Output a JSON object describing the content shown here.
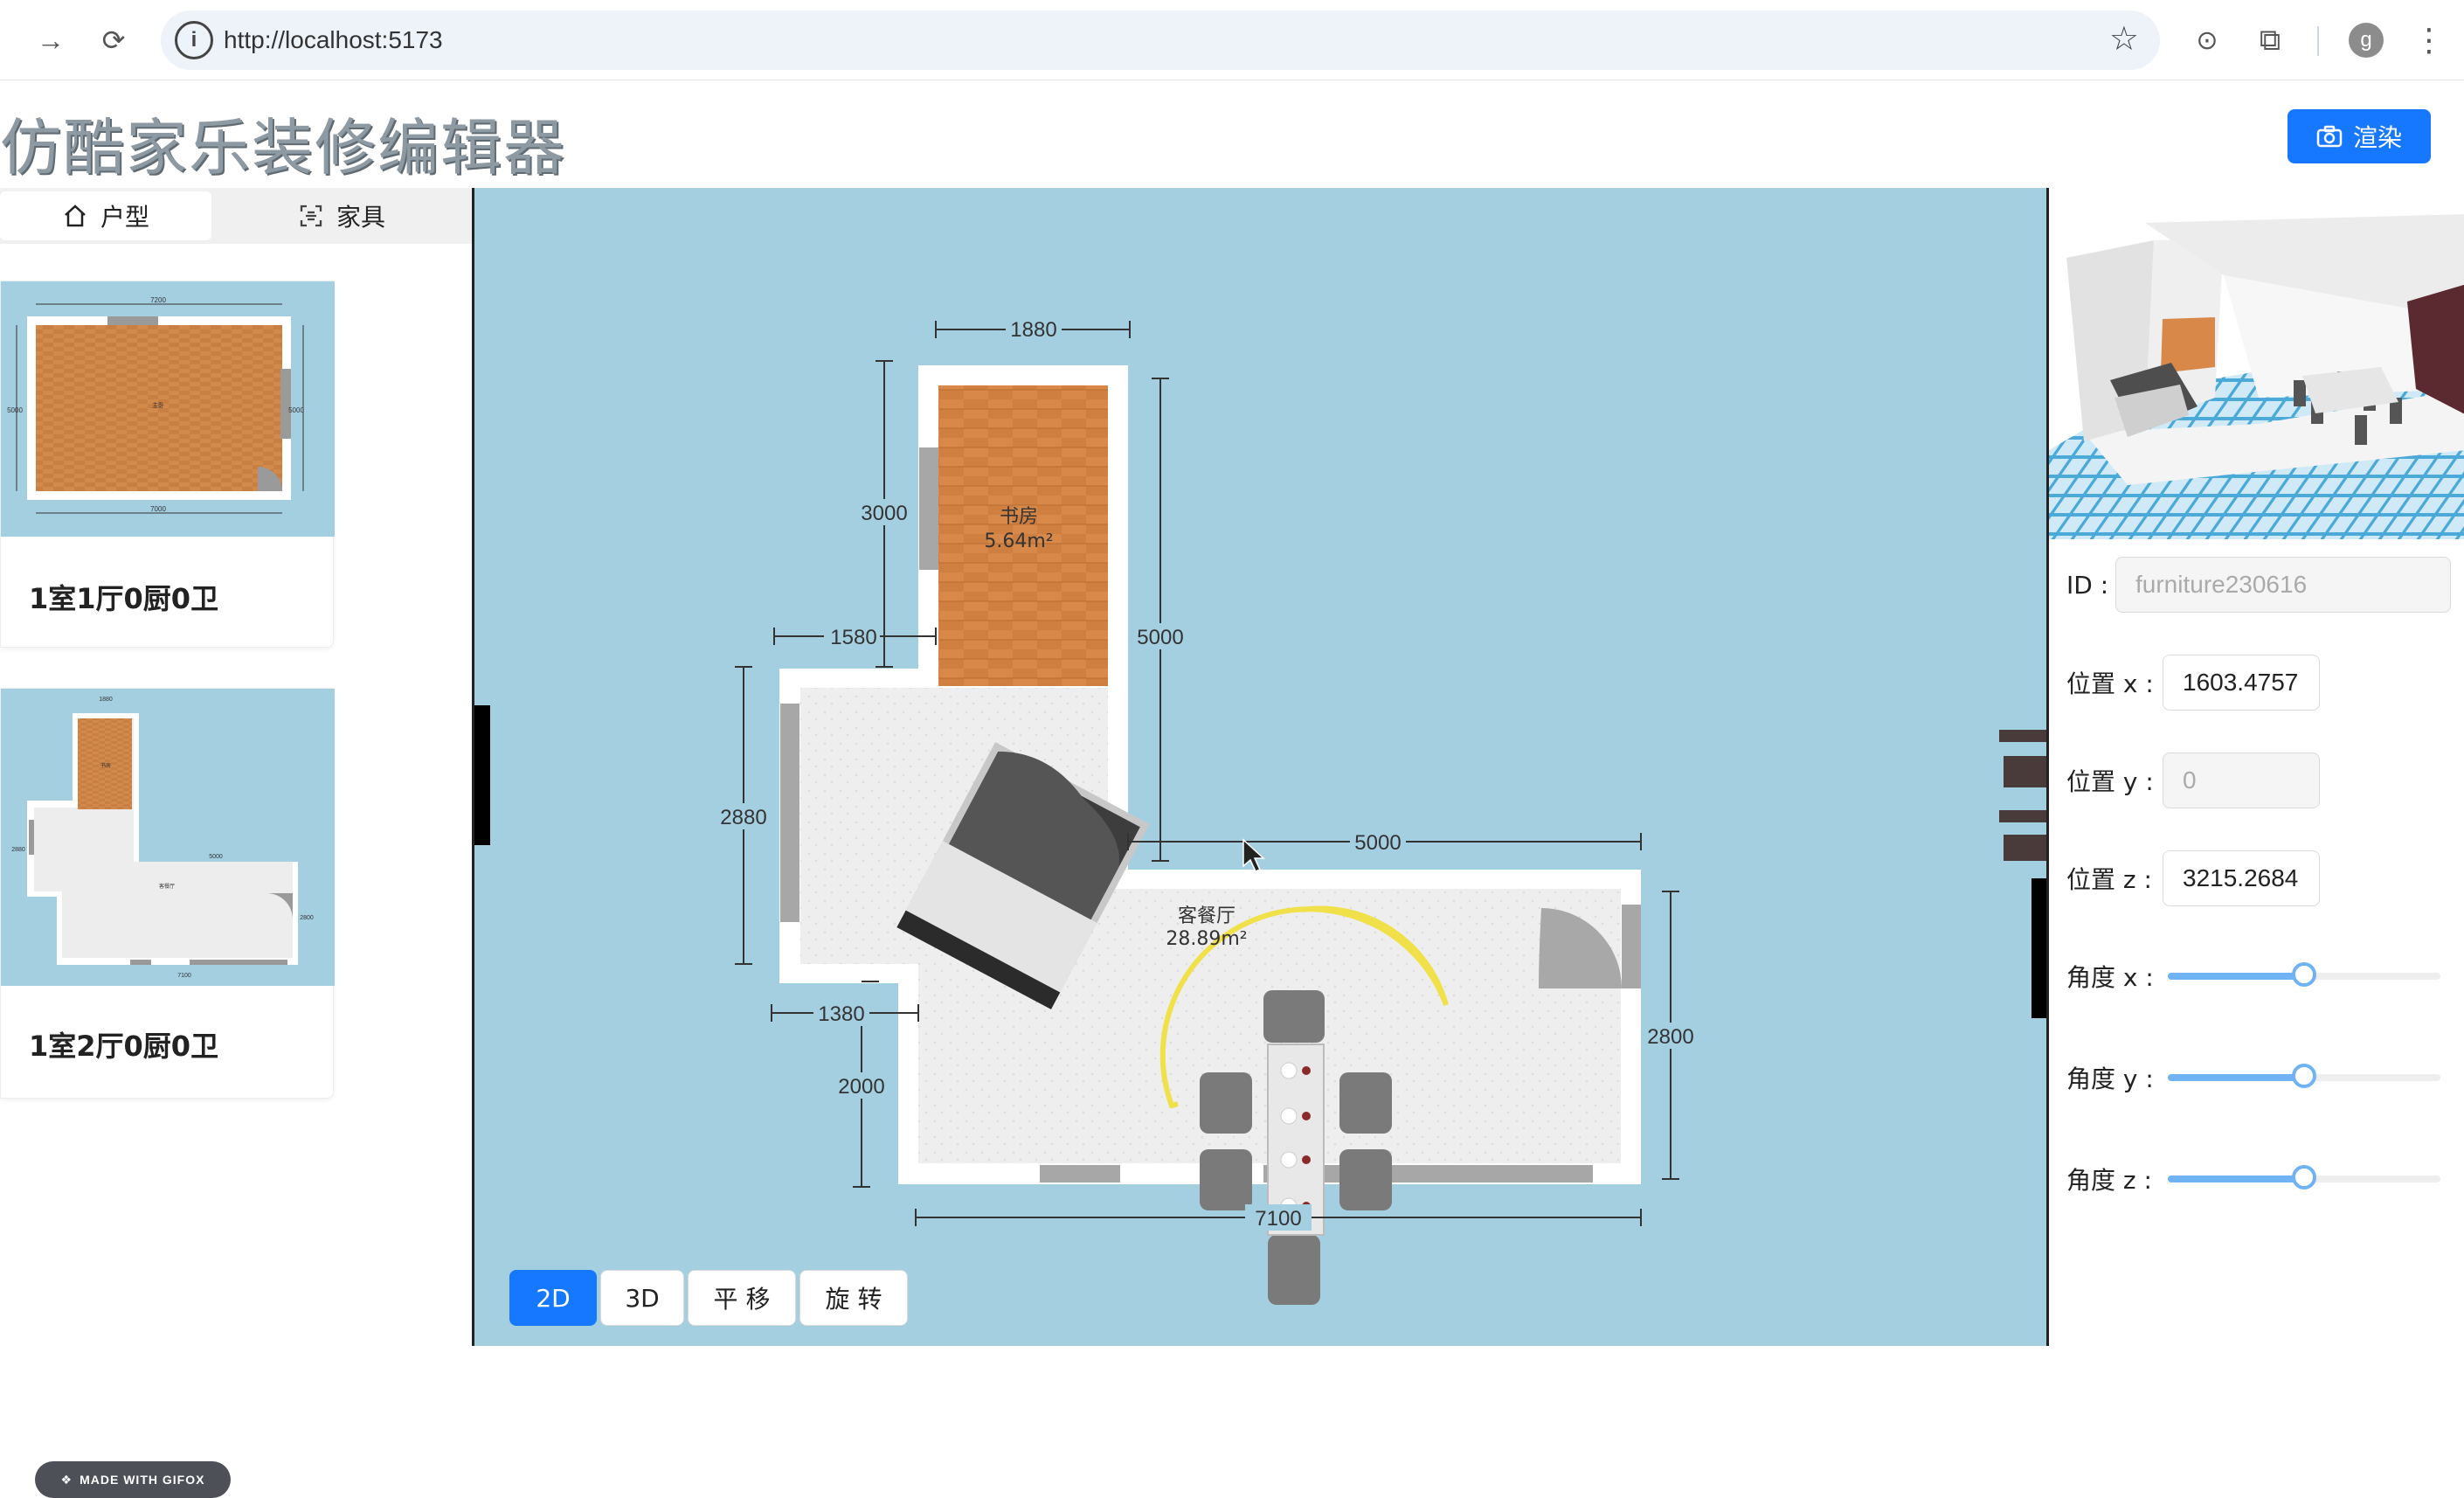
{
  "browser": {
    "url": "http://localhost:5173",
    "avatar_letter": "g"
  },
  "app": {
    "title": "仿酷家乐装修编辑器",
    "render_button": "渲染",
    "accent": "#1677ff"
  },
  "sidebar": {
    "tabs": [
      {
        "label": "户型",
        "icon": "home-icon",
        "active": true
      },
      {
        "label": "家具",
        "icon": "scan-icon",
        "active": false
      }
    ],
    "cards": [
      {
        "name": "1室1厅0厨0卫",
        "dims": {
          "top": "7200",
          "bottom": "7000",
          "left": "5000",
          "right": "5000"
        },
        "room_label": "主卧"
      },
      {
        "name": "1室2厅0厨0卫",
        "dims": {
          "top": "1880",
          "mid": "5000",
          "bottom": "7100",
          "left": "2880",
          "right": "2800",
          "a": "3000",
          "b": "1580",
          "c": "1380",
          "d": "2000"
        },
        "room_labels": [
          "书房",
          "客餐厅"
        ]
      }
    ],
    "watermark": "MADE WITH GIFOX"
  },
  "floorplan": {
    "dimensions": {
      "top_width": "1880",
      "study_height": "3000",
      "study_left": "1580",
      "right_tall": "5000",
      "living_width": "5000",
      "left_height": "2880",
      "step_width": "1380",
      "lower_left": "2000",
      "living_right": "2800",
      "bottom_width": "7100"
    },
    "rooms": [
      {
        "name": "书房",
        "area": "5.64m²"
      },
      {
        "name": "客餐厅",
        "area": "28.89m²"
      }
    ],
    "wall_color": "#ffffff",
    "floor_wood": "#d8894a",
    "floor_tile": "#ececec",
    "water_color": "#a4cfe1"
  },
  "modes": [
    {
      "label": "2D",
      "active": true
    },
    {
      "label": "3D",
      "active": false
    },
    {
      "label": "平 移",
      "active": false
    },
    {
      "label": "旋 转",
      "active": false
    }
  ],
  "properties": {
    "id_label": "ID :",
    "id_value": "furniture230616",
    "pos_x_label": "位置 x :",
    "pos_x_value": "1603.4757",
    "pos_y_label": "位置 y :",
    "pos_y_value": "0",
    "pos_z_label": "位置 z :",
    "pos_z_value": "3215.2684",
    "angle_x_label": "角度 x :",
    "angle_x_value": 0.5,
    "angle_y_label": "角度 y :",
    "angle_y_value": 0.5,
    "angle_z_label": "角度 z :",
    "angle_z_value": 0.5
  }
}
